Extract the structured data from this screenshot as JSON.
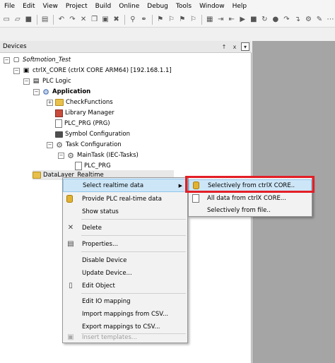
{
  "menubar": [
    "File",
    "Edit",
    "View",
    "Project",
    "Build",
    "Online",
    "Debug",
    "Tools",
    "Window",
    "Help"
  ],
  "devices_panel": {
    "title": "Devices",
    "pin": "↑",
    "close": "x",
    "dropdown": "▾"
  },
  "tree": {
    "project": "Softmotion_Test",
    "device": "ctrlX_CORE (ctrlX CORE ARM64) [192.168.1.1]",
    "plc_logic": "PLC Logic",
    "application": "Application",
    "check_functions": "CheckFunctions",
    "library_manager": "Library Manager",
    "plc_prg": "PLC_PRG (PRG)",
    "symbol_config": "Symbol Configuration",
    "task_config": "Task Configuration",
    "main_task": "MainTask (IEC-Tasks)",
    "plc_prg_call": "PLC_PRG",
    "datalayer": "DataLayer_Realtime"
  },
  "context_menu": [
    {
      "label": "Select realtime data",
      "submenu": true
    },
    {
      "label": "Provide PLC real-time data"
    },
    {
      "label": "Show status"
    },
    {
      "label": "Delete"
    },
    {
      "label": "Properties..."
    },
    {
      "label": "Disable Device"
    },
    {
      "label": "Update Device..."
    },
    {
      "label": "Edit Object"
    },
    {
      "label": "Edit IO mapping"
    },
    {
      "label": "Import mappings from CSV..."
    },
    {
      "label": "Export mappings to CSV..."
    },
    {
      "label": "Insert templates...",
      "disabled": true
    }
  ],
  "submenu": [
    {
      "label": "Selectively from ctrlX CORE.."
    },
    {
      "label": "All data from ctrlX CORE..."
    },
    {
      "label": "Selectively from file.."
    }
  ]
}
